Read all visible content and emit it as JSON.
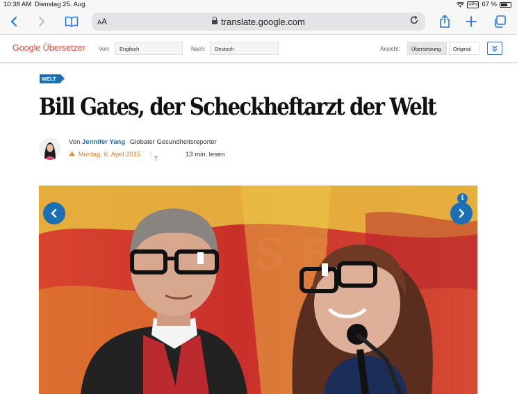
{
  "status_bar": {
    "time": "10:38 AM",
    "date": "Dienstag 25. Aug.",
    "vpn": "VPN",
    "battery": "67 %",
    "battery_level": 0.67
  },
  "browser": {
    "text_size": "AA",
    "url": "translate.google.com"
  },
  "translate_bar": {
    "brand": "Google Übersetzer",
    "from_label": "Von:",
    "from_value": "Englisch",
    "to_label": "Nach:",
    "to_value": "Deutsch",
    "view_label": "Ansicht:",
    "translation_btn": "Übersetzung",
    "original_btn": "Original"
  },
  "article": {
    "section": "WELT",
    "headline": "Bill Gates, der Scheckheftarzt der Welt",
    "by_prefix": "Von",
    "author": "Jennifer Yang",
    "author_role": "Globaler Gesundheitsreporter",
    "date": "Montag, 6. April 2015",
    "date_sep": "|",
    "t_mark": "T",
    "read_time": "13 min. lesen",
    "info_icon_text": "i"
  },
  "colors": {
    "accent": "#1a6fb5",
    "brand_red": "#dd4b39",
    "date_orange": "#e07e21",
    "ios_blue": "#1a73e8"
  }
}
